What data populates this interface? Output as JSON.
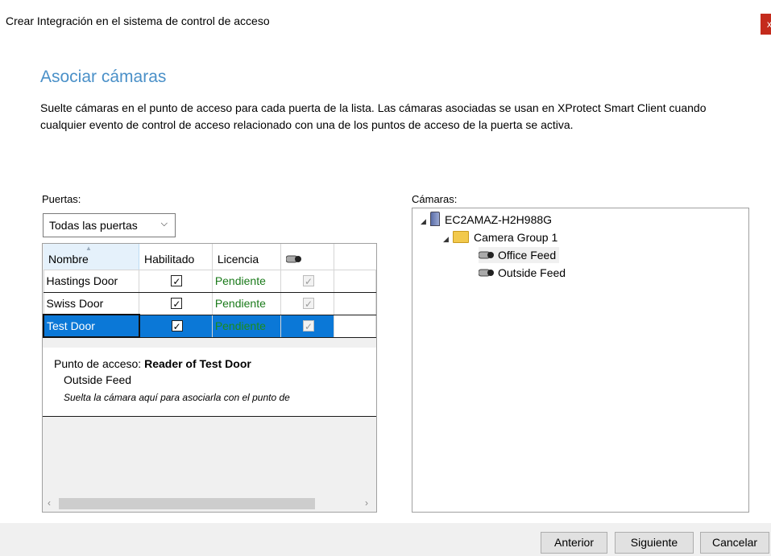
{
  "window": {
    "title": "Crear Integración en el sistema de control de acceso",
    "close_label": "x"
  },
  "page": {
    "heading": "Asociar cámaras",
    "description": "Suelte cámaras en el punto de acceso para cada puerta de la lista. Las cámaras asociadas se usan en XProtect Smart Client cuando cualquier evento de control de acceso relacionado con una de los puntos de acceso de la puerta se activa."
  },
  "doors": {
    "label": "Puertas:",
    "filter_selected": "Todas las puertas",
    "columns": [
      "Nombre",
      "Habilitado",
      "Licencia",
      ""
    ],
    "rows": [
      {
        "name": "Hastings Door",
        "enabled": true,
        "license": "Pendiente"
      },
      {
        "name": "Swiss Door",
        "enabled": true,
        "license": "Pendiente"
      },
      {
        "name": "Test Door",
        "enabled": true,
        "license": "Pendiente",
        "selected": true
      }
    ],
    "detail": {
      "access_point_prefix": "Punto de acceso:",
      "access_point_name": "Reader of Test Door",
      "camera": "Outside Feed",
      "hint": "Suelta la cámara aquí para asociarla con el punto de"
    }
  },
  "cameras": {
    "label": "Cámaras:",
    "server": "EC2AMAZ-H2H988G",
    "group": "Camera Group 1",
    "items": [
      "Office Feed",
      "Outside Feed"
    ]
  },
  "footer": {
    "back_label": "Anterior",
    "next_label": "Siguiente",
    "cancel_label": "Cancelar"
  },
  "colors": {
    "accent": "#4a90c8",
    "selection": "#0b78d7",
    "status_green": "#1a7a1a",
    "close_red": "#c42b1c"
  },
  "icons": [
    "camera-icon",
    "server-icon",
    "folder-icon",
    "chevron-down-icon",
    "expand-triangle-icon"
  ]
}
